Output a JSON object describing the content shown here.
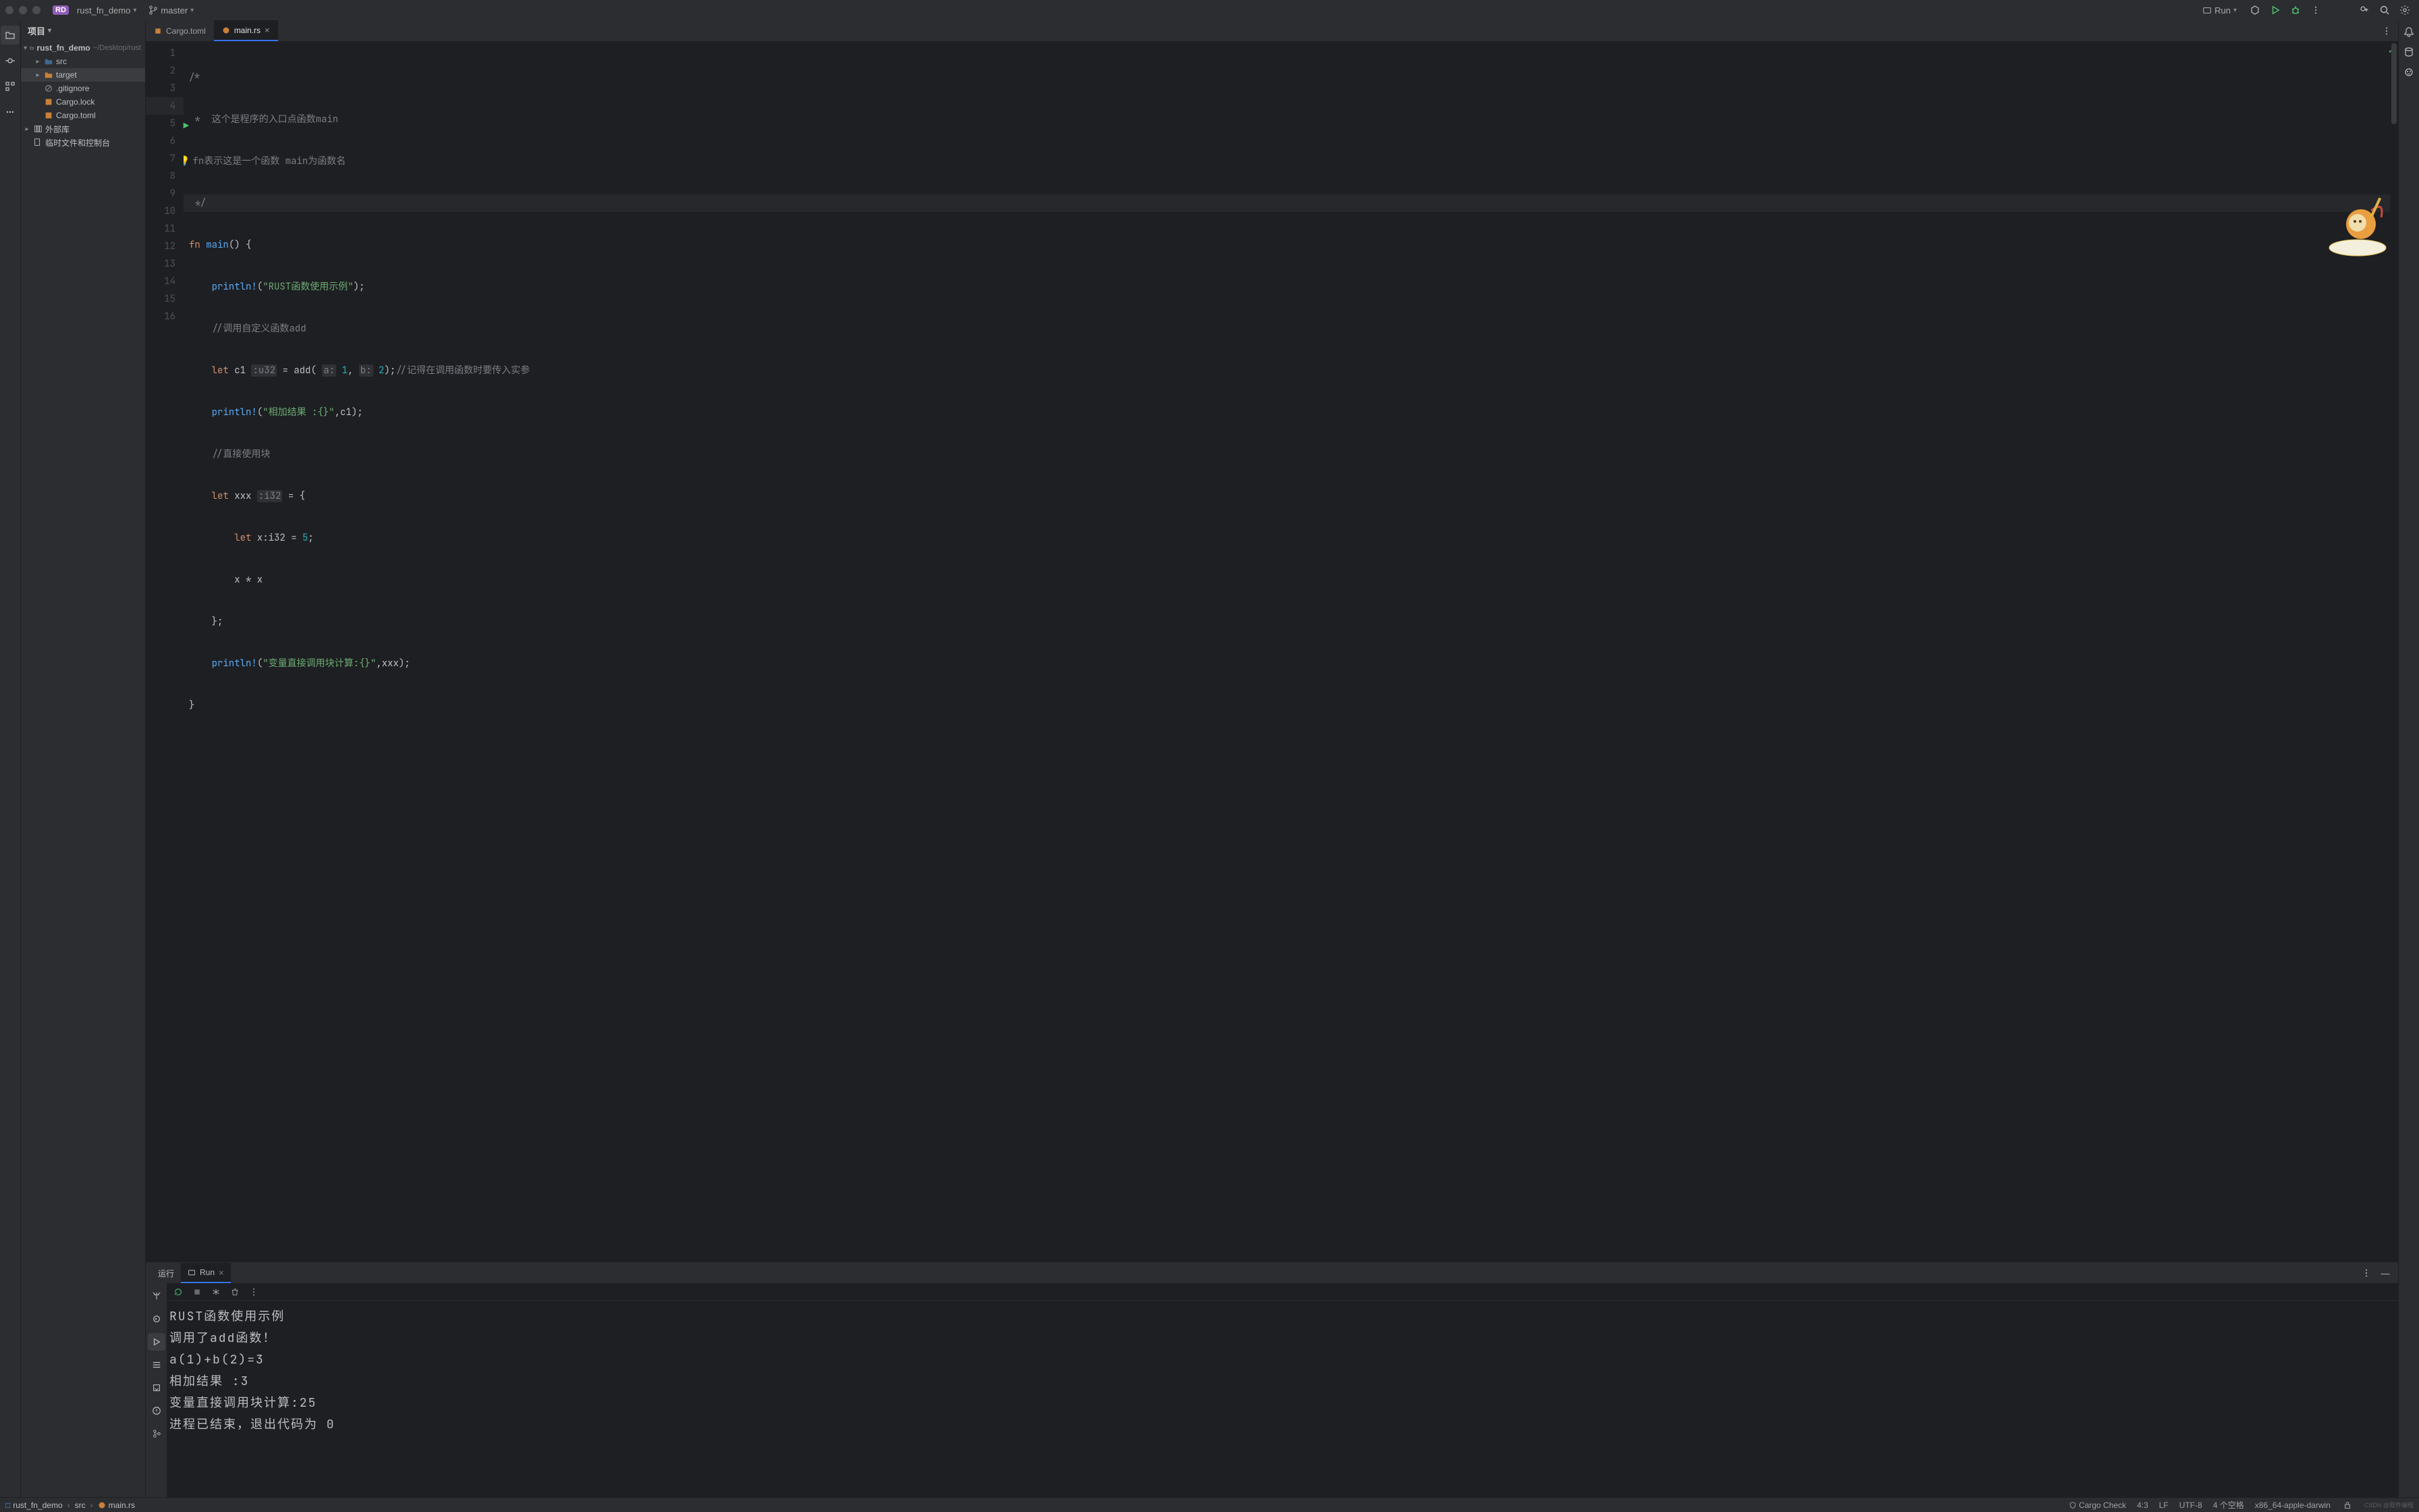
{
  "titlebar": {
    "project_badge": "RD",
    "project_name": "rust_fn_demo",
    "branch_name": "master",
    "run_label": "Run"
  },
  "project": {
    "header": "项目",
    "root": {
      "name": "rust_fn_demo",
      "path": "~/Desktop/rust"
    },
    "nodes": {
      "src": "src",
      "target": "target",
      "gitignore": ".gitignore",
      "cargo_lock": "Cargo.lock",
      "cargo_toml": "Cargo.toml",
      "ext_lib": "外部库",
      "temp_console": "临时文件和控制台"
    }
  },
  "tabs": {
    "cargo_toml": "Cargo.toml",
    "main_rs": "main.rs"
  },
  "code": {
    "l1": "/*",
    "l2a": " *  ",
    "l2b": "这个是程序的入口点函数main",
    "l3a": " *",
    "l3b": "fn表示这是一个函数 main为函数名",
    "l4": " */",
    "l5_fn": "fn",
    "l5_name": "main",
    "l5_rest": "() {",
    "l6_macro": "println!",
    "l6_str": "\"RUST函数使用示例\"",
    "l6_end": ");",
    "l7": "//调用自定义函数add",
    "l8_let": "let",
    "l8_c1": "c1",
    "l8_ty": ":u32",
    "l8_eq": " = ",
    "l8_add": "add(",
    "l8_ah": "a:",
    "l8_a": "1",
    "l8_comma": ", ",
    "l8_bh": "b:",
    "l8_b": "2",
    "l8_close": ");",
    "l8_comment": "//记得在调用函数时要传入实参",
    "l9_macro": "println!",
    "l9_str": "\"相加结果 :{}\"",
    "l9_end": ",c1);",
    "l10": "//直接使用块",
    "l11_let": "let",
    "l11_x": "xxx",
    "l11_ty": ":i32",
    "l11_rest": " = {",
    "l12_let": "let",
    "l12_rest": " x:i32 = ",
    "l12_num": "5",
    "l12_semi": ";",
    "l13": "x * x",
    "l14": "};",
    "l15_macro": "println!",
    "l15_str": "\"变量直接调用块计算:{}\"",
    "l15_end": ",xxx);",
    "l16": "}"
  },
  "gutter": {
    "n1": "1",
    "n2": "2",
    "n3": "3",
    "n4": "4",
    "n5": "5",
    "n6": "6",
    "n7": "7",
    "n8": "8",
    "n9": "9",
    "n10": "10",
    "n11": "11",
    "n12": "12",
    "n13": "13",
    "n14": "14",
    "n15": "15",
    "n16": "16"
  },
  "run": {
    "tab_run_label": "运行",
    "tab_config": "Run",
    "console_lines": {
      "l1": "RUST函数使用示例",
      "l2": "调用了add函数！",
      "l3": "a(1)+b(2)=3",
      "l4": "相加结果 :3",
      "l5": "变量直接调用块计算:25",
      "l6": "",
      "l7": "进程已结束，退出代码为 0"
    }
  },
  "breadcrumbs": {
    "p1": "rust_fn_demo",
    "p2": "src",
    "p3": "main.rs"
  },
  "statusbar": {
    "cargo_check": "Cargo Check",
    "line_col": "4:3",
    "line_end": "LF",
    "encoding": "UTF-8",
    "indent": "4 个空格",
    "target": "x86_64-apple-darwin"
  }
}
